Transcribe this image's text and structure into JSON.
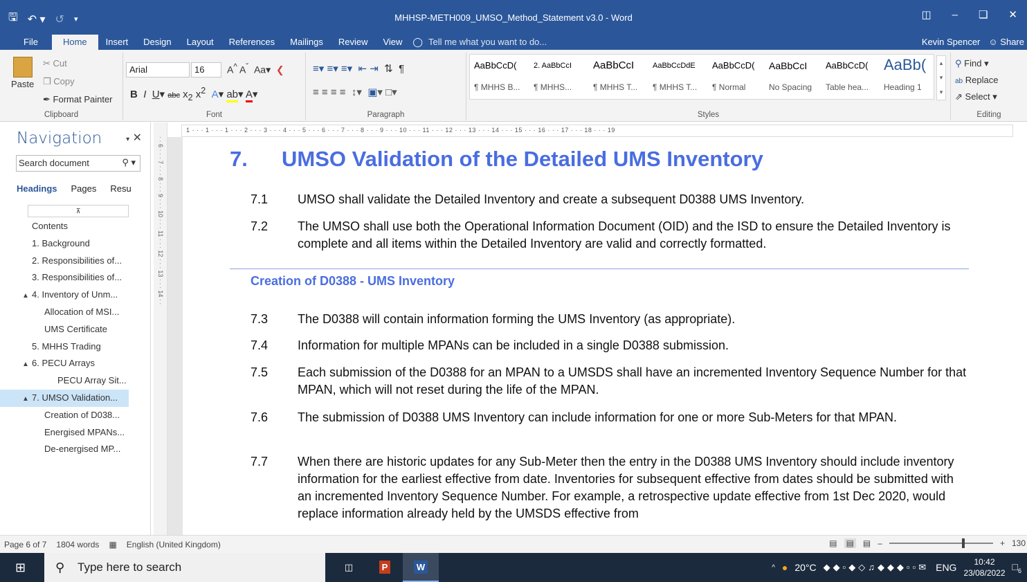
{
  "window": {
    "title": "MHHSP-METH009_UMSO_Method_Statement v3.0 - Word"
  },
  "tabs": [
    "File",
    "Home",
    "Insert",
    "Design",
    "Layout",
    "References",
    "Mailings",
    "Review",
    "View"
  ],
  "tell_me": "Tell me what you want to do...",
  "user": "Kevin Spencer",
  "share": "Share",
  "ribbon": {
    "clipboard": {
      "paste": "Paste",
      "cut": "Cut",
      "copy": "Copy",
      "format_painter": "Format Painter",
      "label": "Clipboard"
    },
    "font": {
      "name": "Arial",
      "size": "16",
      "label": "Font"
    },
    "paragraph": {
      "label": "Paragraph"
    },
    "styles": {
      "label": "Styles",
      "items": [
        {
          "preview": "AaBbCcD(",
          "name": "¶ MHHS B..."
        },
        {
          "preview": "2. AaBbCcI",
          "name": "¶ MHHS..."
        },
        {
          "preview": "AaBbCcI",
          "name": "¶ MHHS T..."
        },
        {
          "preview": "AaBbCcDdE",
          "name": "¶ MHHS T..."
        },
        {
          "preview": "AaBbCcD(",
          "name": "¶ Normal"
        },
        {
          "preview": "AaBbCcI",
          "name": "No Spacing"
        },
        {
          "preview": "AaBbCcD(",
          "name": "Table hea..."
        },
        {
          "preview": "AaBb(",
          "name": "Heading 1"
        }
      ]
    },
    "editing": {
      "find": "Find",
      "replace": "Replace",
      "select": "Select",
      "label": "Editing"
    }
  },
  "navigation": {
    "title": "Navigation",
    "search_placeholder": "Search document",
    "tabs": [
      "Headings",
      "Pages",
      "Resu"
    ],
    "items": [
      {
        "label": "Contents",
        "level": 0,
        "tri": ""
      },
      {
        "label": "1. Background",
        "level": 0,
        "tri": ""
      },
      {
        "label": "2. Responsibilities of...",
        "level": 0,
        "tri": ""
      },
      {
        "label": "3. Responsibilities of...",
        "level": 0,
        "tri": ""
      },
      {
        "label": "4. Inventory of Unm...",
        "level": 0,
        "tri": "◢"
      },
      {
        "label": "Allocation of MSI...",
        "level": 1,
        "tri": ""
      },
      {
        "label": "UMS Certificate",
        "level": 1,
        "tri": ""
      },
      {
        "label": "5. MHHS Trading",
        "level": 0,
        "tri": ""
      },
      {
        "label": "6. PECU Arrays",
        "level": 0,
        "tri": "◢"
      },
      {
        "label": "PECU Array Sit...",
        "level": 2,
        "tri": ""
      },
      {
        "label": "7. UMSO Validation...",
        "level": 0,
        "tri": "◢"
      },
      {
        "label": "Creation of D038...",
        "level": 1,
        "tri": ""
      },
      {
        "label": "Energised MPANs...",
        "level": 1,
        "tri": ""
      },
      {
        "label": "De-energised MP...",
        "level": 1,
        "tri": ""
      }
    ]
  },
  "document": {
    "heading_num": "7.",
    "heading_text": "UMSO Validation of the Detailed UMS Inventory",
    "subheading": "Creation of D0388 - UMS Inventory",
    "paragraphs": [
      {
        "num": "7.1",
        "text": "UMSO shall validate the Detailed Inventory and create a subsequent D0388 UMS Inventory."
      },
      {
        "num": "7.2",
        "text": "The UMSO shall use both the Operational Information Document (OID) and the ISD to ensure the Detailed Inventory is complete and all items within the Detailed Inventory are valid and correctly formatted."
      },
      {
        "num": "7.3",
        "text": "The D0388 will contain information forming the UMS Inventory (as appropriate)."
      },
      {
        "num": "7.4",
        "text": "Information for multiple MPANs can be included in a single D0388 submission."
      },
      {
        "num": "7.5",
        "text": "Each submission of the D0388 for an MPAN to a UMSDS shall have an incremented Inventory Sequence Number for that MPAN, which will not reset during the life of the MPAN."
      },
      {
        "num": "7.6",
        "text": "The submission of D0388 UMS Inventory can include information for one or more Sub-Meters for that MPAN."
      },
      {
        "num": "7.7",
        "text": "When there are historic updates for any Sub-Meter then the entry in the D0388 UMS Inventory should include inventory information for the earliest effective from date. Inventories for subsequent effective from dates should be submitted with an incremented Inventory Sequence Number. For example, a retrospective update effective from 1st Dec 2020, would replace information already held by the UMSDS effective from"
      }
    ]
  },
  "ruler": "1 · · · 1 · · · 1 · · · 2 · · · 3 · · · 4 · · · 5 · · · 6 · · · 7 · · · 8 · · · 9 · · · 10 · · · 11 · · · 12 · · · 13 · · · 14 · · · 15 · · · 16 · · · 17 · · · 18 · · · 19",
  "status": {
    "page": "Page 6 of 7",
    "words": "1804 words",
    "language": "English (United Kingdom)",
    "zoom": "130",
    "zoom_fraction": 0.72
  },
  "taskbar": {
    "search_placeholder": "Type here to search",
    "weather": "20°C",
    "lang": "ENG",
    "time": "10:42",
    "date": "23/08/2022",
    "notifications": "6"
  }
}
